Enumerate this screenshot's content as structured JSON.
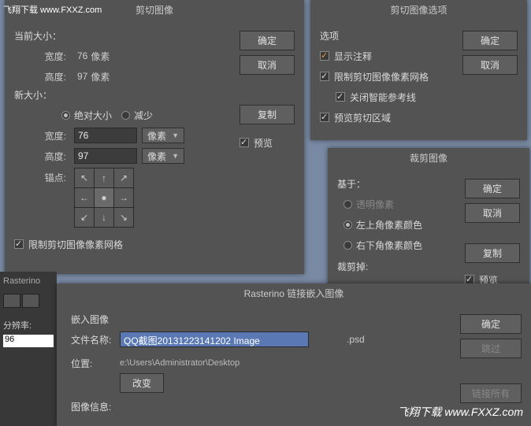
{
  "watermark": {
    "tl": "飞翔下载 www.FXXZ.com",
    "br": "飞翔下载 www.FXXZ.com"
  },
  "crop": {
    "title": "剪切图像",
    "current_size_label": "当前大小：",
    "width_label": "宽度:",
    "width_val": "76",
    "width_unit": "像素",
    "height_label": "高度:",
    "height_val": "97",
    "height_unit": "像素",
    "new_size_label": "新大小：",
    "abs_label": "绝对大小",
    "reduce_label": "减少",
    "new_width": "76",
    "new_height": "97",
    "unit_px": "像素",
    "anchor_label": "锚点:",
    "limit_grid": "限制剪切图像像素网格",
    "ok": "确定",
    "cancel": "取消",
    "copy": "复制",
    "preview": "预览"
  },
  "options": {
    "title": "剪切图像选项",
    "section": "选项",
    "show_anno": "显示注释",
    "limit_grid": "限制剪切图像像素网格",
    "close_guides": "关闭智能参考线",
    "preview_area": "预览剪切区域",
    "ok": "确定",
    "cancel": "取消"
  },
  "trim": {
    "title": "裁剪图像",
    "based_on": "基于：",
    "transparent": "透明像素",
    "top_left": "左上角像素颜色",
    "bottom_right": "右下角像素颜色",
    "trim_away": "裁剪掉:",
    "ok": "确定",
    "cancel": "取消",
    "copy": "复制",
    "preview": "预览"
  },
  "link": {
    "title": "Rasterino 链接嵌入图像",
    "section": "嵌入图像",
    "filename_label": "文件名称:",
    "filename_val": "QQ截图20131223141202 Image",
    "ext": ".psd",
    "location_label": "位置:",
    "location_val": "e:\\Users\\Administrator\\Desktop",
    "change": "改变",
    "info": "图像信息:",
    "ok": "确定",
    "skip": "跳过",
    "link_all": "链接所有"
  },
  "sidebar": {
    "app": "Rasterino",
    "res_label": "分辨率:",
    "res_val": "96"
  }
}
